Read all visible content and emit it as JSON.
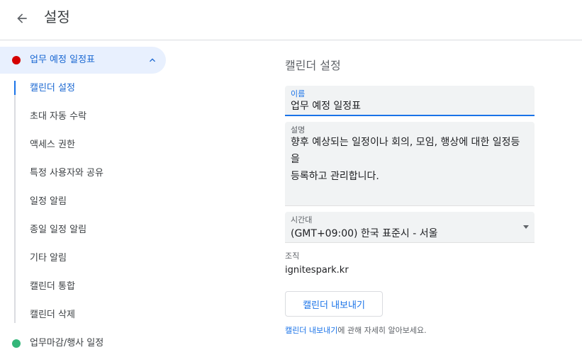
{
  "header": {
    "title": "설정",
    "back_icon": "arrow-back-icon"
  },
  "sidebar": {
    "calendar": {
      "name": "업무 예정 일정표",
      "color": "#d50000"
    },
    "items": [
      {
        "label": "캘린더 설정",
        "active": true
      },
      {
        "label": "초대 자동 수락"
      },
      {
        "label": "액세스 권한"
      },
      {
        "label": "특정 사용자와 공유"
      },
      {
        "label": "일정 알림"
      },
      {
        "label": "종일 일정 알림"
      },
      {
        "label": "기타 알림"
      },
      {
        "label": "캘린더 통합"
      },
      {
        "label": "캘린더 삭제"
      }
    ],
    "other_calendar": {
      "name": "업무마감/행사 일정",
      "color": "#33b679"
    }
  },
  "main": {
    "section_title": "캘린더 설정",
    "name_field": {
      "label": "이름",
      "value": "업무 예정 일정표"
    },
    "description_field": {
      "label": "설명",
      "value": "향후 예상되는 일정이나 회의, 모임, 행상에 대한 일정등을\n등록하고 관리합니다."
    },
    "timezone_field": {
      "label": "시간대",
      "value": "(GMT+09:00) 한국 표준시 - 서울"
    },
    "organization": {
      "label": "조직",
      "value": "ignitespark.kr"
    },
    "export_button": "캘린더 내보내기",
    "help": {
      "link": "캘린더 내보내기",
      "text": "에 관해 자세히 알아보세요."
    }
  },
  "colors": {
    "accent": "#1a73e8",
    "active_bg": "#e8f0fe"
  }
}
